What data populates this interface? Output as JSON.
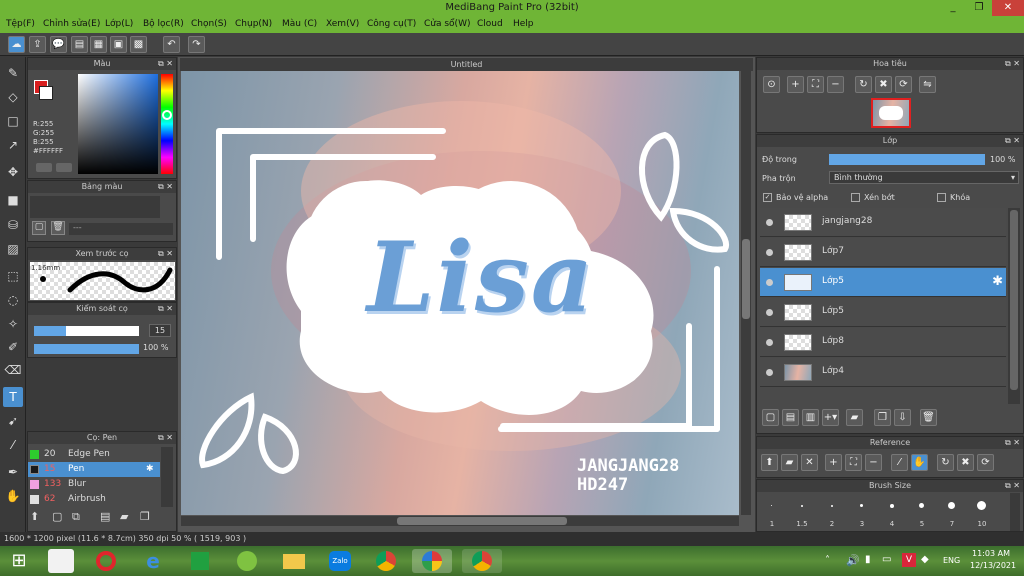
{
  "window": {
    "title": "MediBang Paint Pro (32bit)",
    "minimize": "_",
    "restore": "❐",
    "close": "✕"
  },
  "menu": [
    "Tệp(F)",
    "Chỉnh sửa(E)",
    "Lớp(L)",
    "Bộ lọc(R)",
    "Chọn(S)",
    "Chụp(N)",
    "Màu (C)",
    "Xem(V)",
    "Công cụ(T)",
    "Cửa sổ(W)",
    "Cloud",
    "Help"
  ],
  "colors": {
    "accent_green": "#6fb536",
    "selected_blue": "#4a90d0",
    "primary_color": "#d81e1e",
    "secondary_color": "#ffffff"
  },
  "color_panel": {
    "title": "Màu",
    "r": "R:255",
    "g": "G:255",
    "b": "B:255",
    "hex": "#FFFFFF"
  },
  "palette_panel": {
    "title": "Bảng màu",
    "value": "---"
  },
  "brush_preview": {
    "title": "Xem trước cọ",
    "size": "1.16mm"
  },
  "brush_control": {
    "title": "Kiểm soát cọ",
    "size_value": "15",
    "size_fill": 0.3,
    "opacity_value": "100 %",
    "opacity_fill": 1.0
  },
  "brush_list": {
    "title": "Cọ: Pen",
    "items": [
      {
        "size": "20",
        "name": "Edge Pen",
        "swatch": "#2ecc2e",
        "selected": false
      },
      {
        "size": "15",
        "name": "Pen",
        "swatch": "#1a1a1a",
        "selected": true
      },
      {
        "size": "133",
        "name": "Blur",
        "swatch": "#f0a0e0",
        "selected": false
      },
      {
        "size": "62",
        "name": "Airbrush",
        "swatch": "#e0e0e0",
        "selected": false
      }
    ]
  },
  "document": {
    "tab": "Untitled",
    "signature_line1": "JANGJANG28",
    "signature_line2": "HD247",
    "main_text": "Lisa"
  },
  "navigator": {
    "title": "Hoa tiêu"
  },
  "layer_panel": {
    "title": "Lớp",
    "opacity_label": "Độ trong",
    "opacity_value": "100 %",
    "opacity_fill": 1.0,
    "blend_label": "Pha trộn",
    "blend_value": "Bình thường",
    "protect_alpha": "Bảo vệ alpha",
    "protect_alpha_checked": true,
    "clipping": "Xén bớt",
    "lock": "Khóa",
    "layers": [
      {
        "name": "jangjang28",
        "selected": false
      },
      {
        "name": "Lớp7",
        "selected": false
      },
      {
        "name": "Lớp5",
        "selected": true
      },
      {
        "name": "Lớp5",
        "selected": false
      },
      {
        "name": "Lớp8",
        "selected": false
      },
      {
        "name": "Lớp4",
        "selected": false
      }
    ]
  },
  "reference_panel": {
    "title": "Reference"
  },
  "brush_size_panel": {
    "title": "Brush Size",
    "sizes": [
      "1",
      "1.5",
      "2",
      "3",
      "4",
      "5",
      "7",
      "10"
    ]
  },
  "status": {
    "text": "1600 * 1200 pixel   (11.6 * 8.7cm)   350 dpi   50 %   ( 1519, 903 )"
  },
  "taskbar": {
    "lang": "ENG",
    "time": "11:03 AM",
    "date": "12/13/2021",
    "zalo": "Zalo"
  }
}
